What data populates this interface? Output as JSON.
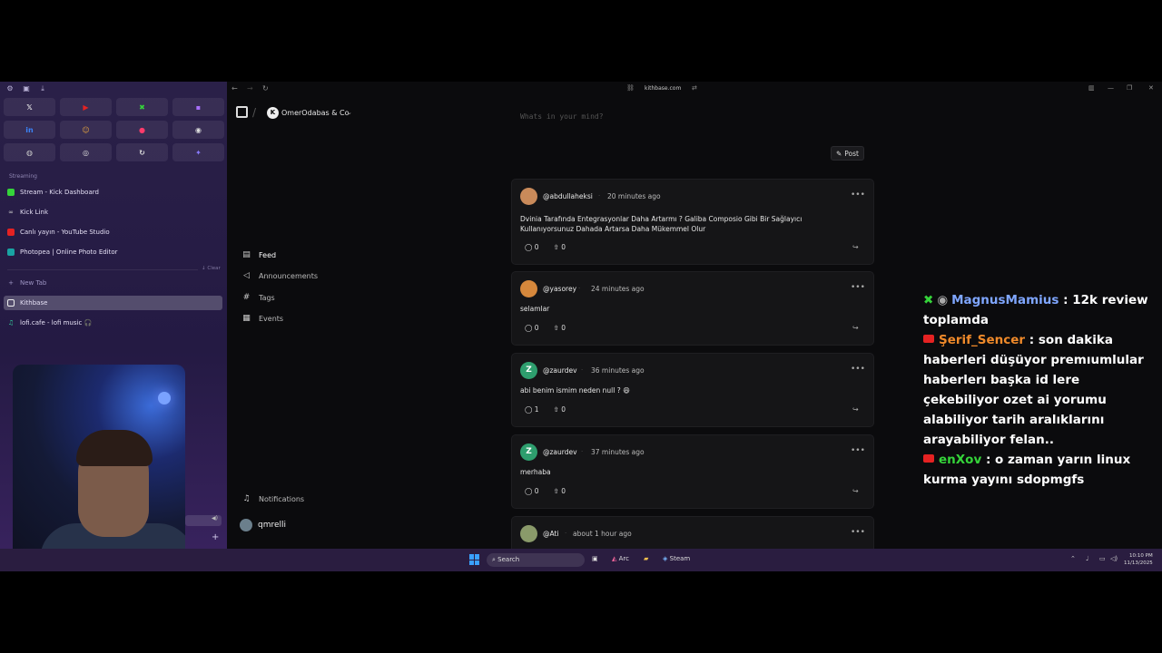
{
  "browser": {
    "url": "kithbase.com"
  },
  "sidebar": {
    "section_label": "Streaming",
    "pinned": [
      {
        "label": "Stream - Kick Dashboard",
        "icon_color": "#35d43a"
      },
      {
        "label": "Kick Link",
        "icon_color": "#cccccc"
      },
      {
        "label": "Canlı yayın - YouTube Studio",
        "icon_color": "#e52222"
      },
      {
        "label": "Photopea | Online Photo Editor",
        "icon_color": "#19a3a3"
      }
    ],
    "clear_label": "↓ Clear",
    "new_tab_label": "New Tab",
    "tabs": [
      {
        "label": "Kithbase",
        "active": true
      },
      {
        "label": "lofi.cafe - lofi music 🎧",
        "active": false
      }
    ]
  },
  "app": {
    "org_name": "OmerOdabas & Co",
    "nav": [
      {
        "label": "Feed",
        "icon": "feed-icon",
        "active": true
      },
      {
        "label": "Announcements",
        "icon": "megaphone-icon",
        "active": false
      },
      {
        "label": "Tags",
        "icon": "hash-icon",
        "active": false
      },
      {
        "label": "Events",
        "icon": "calendar-icon",
        "active": false
      }
    ],
    "notifications_label": "Notifications",
    "user_name": "qmrelli"
  },
  "composer": {
    "placeholder": "Whats in your mind?",
    "post_label": "Post"
  },
  "posts": [
    {
      "handle": "@abdullaheksi",
      "time": "20 minutes ago",
      "body": "Dvinia Tarafında Entegrasyonlar Daha Artarmı ? Galiba Composio Gibi Bir Sağlayıcı Kullanıyorsunuz Dahada Artarsa Daha Mükemmel Olur",
      "comments": "0",
      "upvotes": "0",
      "avatar_letter": "",
      "avatar_color": "#c98a5a"
    },
    {
      "handle": "@yasorey",
      "time": "24 minutes ago",
      "body": "selamlar",
      "comments": "0",
      "upvotes": "0",
      "avatar_letter": "",
      "avatar_color": "#d6883c"
    },
    {
      "handle": "@zaurdev",
      "time": "36 minutes ago",
      "body": "abi benim ismim neden null ? 😄",
      "comments": "1",
      "upvotes": "0",
      "avatar_letter": "Z",
      "avatar_color": "#2e9e6e"
    },
    {
      "handle": "@zaurdev",
      "time": "37 minutes ago",
      "body": "merhaba",
      "comments": "0",
      "upvotes": "0",
      "avatar_letter": "Z",
      "avatar_color": "#2e9e6e"
    },
    {
      "handle": "@Ati",
      "time": "about 1 hour ago",
      "body": "",
      "comments": "",
      "upvotes": "",
      "avatar_letter": "",
      "avatar_color": "#8a9a6a"
    }
  ],
  "chat": [
    {
      "platform": "kick",
      "user": "MagnusMamius",
      "user_color": "#7fa6ff",
      "message": " : 12k review toplamda"
    },
    {
      "platform": "youtube",
      "user": "Şerif_Sencer",
      "user_color": "#f08a2a",
      "message": " : son dakika haberleri düşüyor premıumlular haberlerı başka id lere çekebiliyor ozet ai yorumu alabiliyor tarih aralıklarını arayabiliyor felan.."
    },
    {
      "platform": "youtube",
      "user": "enXov",
      "user_color": "#35d43a",
      "message": " : o zaman yarın linux kurma yayını sdopmgfs"
    }
  ],
  "taskbar": {
    "search_label": "Search",
    "apps": [
      "Arc",
      "Steam"
    ],
    "time": "10:10 PM",
    "date": "11/13/2025"
  }
}
